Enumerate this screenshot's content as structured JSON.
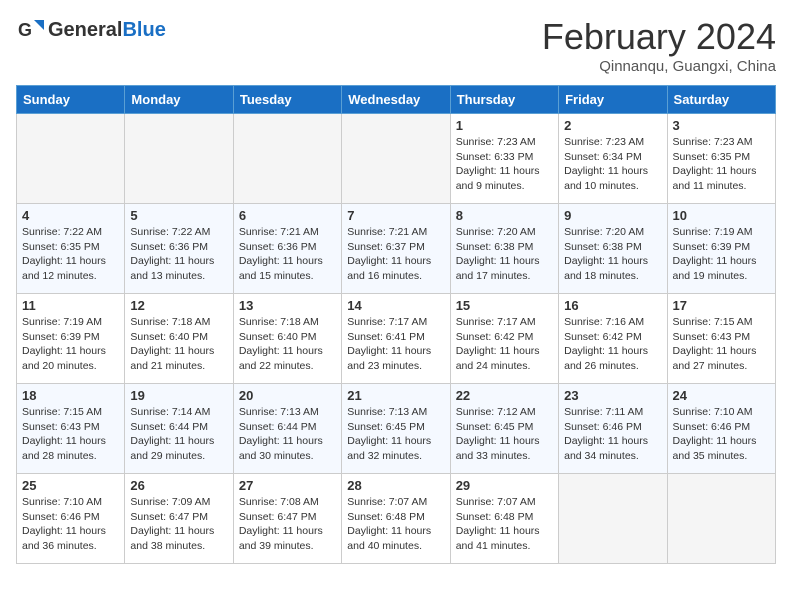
{
  "header": {
    "logo_general": "General",
    "logo_blue": "Blue",
    "title": "February 2024",
    "subtitle": "Qinnanqu, Guangxi, China"
  },
  "days_of_week": [
    "Sunday",
    "Monday",
    "Tuesday",
    "Wednesday",
    "Thursday",
    "Friday",
    "Saturday"
  ],
  "weeks": [
    [
      {
        "day": "",
        "info": ""
      },
      {
        "day": "",
        "info": ""
      },
      {
        "day": "",
        "info": ""
      },
      {
        "day": "",
        "info": ""
      },
      {
        "day": "1",
        "info": "Sunrise: 7:23 AM\nSunset: 6:33 PM\nDaylight: 11 hours and 9 minutes."
      },
      {
        "day": "2",
        "info": "Sunrise: 7:23 AM\nSunset: 6:34 PM\nDaylight: 11 hours and 10 minutes."
      },
      {
        "day": "3",
        "info": "Sunrise: 7:23 AM\nSunset: 6:35 PM\nDaylight: 11 hours and 11 minutes."
      }
    ],
    [
      {
        "day": "4",
        "info": "Sunrise: 7:22 AM\nSunset: 6:35 PM\nDaylight: 11 hours and 12 minutes."
      },
      {
        "day": "5",
        "info": "Sunrise: 7:22 AM\nSunset: 6:36 PM\nDaylight: 11 hours and 13 minutes."
      },
      {
        "day": "6",
        "info": "Sunrise: 7:21 AM\nSunset: 6:36 PM\nDaylight: 11 hours and 15 minutes."
      },
      {
        "day": "7",
        "info": "Sunrise: 7:21 AM\nSunset: 6:37 PM\nDaylight: 11 hours and 16 minutes."
      },
      {
        "day": "8",
        "info": "Sunrise: 7:20 AM\nSunset: 6:38 PM\nDaylight: 11 hours and 17 minutes."
      },
      {
        "day": "9",
        "info": "Sunrise: 7:20 AM\nSunset: 6:38 PM\nDaylight: 11 hours and 18 minutes."
      },
      {
        "day": "10",
        "info": "Sunrise: 7:19 AM\nSunset: 6:39 PM\nDaylight: 11 hours and 19 minutes."
      }
    ],
    [
      {
        "day": "11",
        "info": "Sunrise: 7:19 AM\nSunset: 6:39 PM\nDaylight: 11 hours and 20 minutes."
      },
      {
        "day": "12",
        "info": "Sunrise: 7:18 AM\nSunset: 6:40 PM\nDaylight: 11 hours and 21 minutes."
      },
      {
        "day": "13",
        "info": "Sunrise: 7:18 AM\nSunset: 6:40 PM\nDaylight: 11 hours and 22 minutes."
      },
      {
        "day": "14",
        "info": "Sunrise: 7:17 AM\nSunset: 6:41 PM\nDaylight: 11 hours and 23 minutes."
      },
      {
        "day": "15",
        "info": "Sunrise: 7:17 AM\nSunset: 6:42 PM\nDaylight: 11 hours and 24 minutes."
      },
      {
        "day": "16",
        "info": "Sunrise: 7:16 AM\nSunset: 6:42 PM\nDaylight: 11 hours and 26 minutes."
      },
      {
        "day": "17",
        "info": "Sunrise: 7:15 AM\nSunset: 6:43 PM\nDaylight: 11 hours and 27 minutes."
      }
    ],
    [
      {
        "day": "18",
        "info": "Sunrise: 7:15 AM\nSunset: 6:43 PM\nDaylight: 11 hours and 28 minutes."
      },
      {
        "day": "19",
        "info": "Sunrise: 7:14 AM\nSunset: 6:44 PM\nDaylight: 11 hours and 29 minutes."
      },
      {
        "day": "20",
        "info": "Sunrise: 7:13 AM\nSunset: 6:44 PM\nDaylight: 11 hours and 30 minutes."
      },
      {
        "day": "21",
        "info": "Sunrise: 7:13 AM\nSunset: 6:45 PM\nDaylight: 11 hours and 32 minutes."
      },
      {
        "day": "22",
        "info": "Sunrise: 7:12 AM\nSunset: 6:45 PM\nDaylight: 11 hours and 33 minutes."
      },
      {
        "day": "23",
        "info": "Sunrise: 7:11 AM\nSunset: 6:46 PM\nDaylight: 11 hours and 34 minutes."
      },
      {
        "day": "24",
        "info": "Sunrise: 7:10 AM\nSunset: 6:46 PM\nDaylight: 11 hours and 35 minutes."
      }
    ],
    [
      {
        "day": "25",
        "info": "Sunrise: 7:10 AM\nSunset: 6:46 PM\nDaylight: 11 hours and 36 minutes."
      },
      {
        "day": "26",
        "info": "Sunrise: 7:09 AM\nSunset: 6:47 PM\nDaylight: 11 hours and 38 minutes."
      },
      {
        "day": "27",
        "info": "Sunrise: 7:08 AM\nSunset: 6:47 PM\nDaylight: 11 hours and 39 minutes."
      },
      {
        "day": "28",
        "info": "Sunrise: 7:07 AM\nSunset: 6:48 PM\nDaylight: 11 hours and 40 minutes."
      },
      {
        "day": "29",
        "info": "Sunrise: 7:07 AM\nSunset: 6:48 PM\nDaylight: 11 hours and 41 minutes."
      },
      {
        "day": "",
        "info": ""
      },
      {
        "day": "",
        "info": ""
      }
    ]
  ]
}
